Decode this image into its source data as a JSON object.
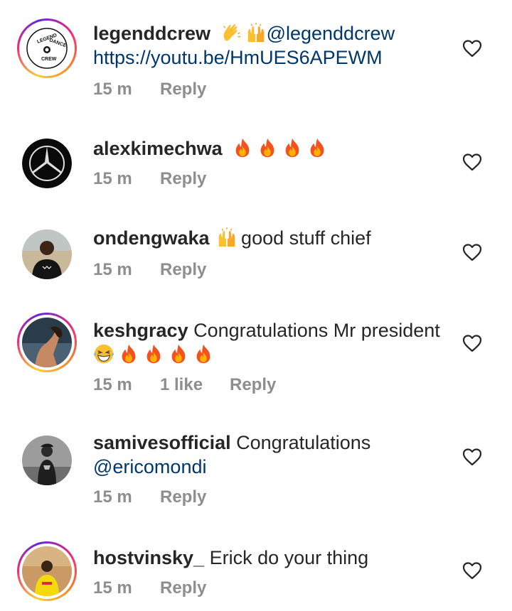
{
  "comments": [
    {
      "username": "legenddcrew",
      "emojis_before": [
        "clapping-hands-emoji",
        "raising-hands-emoji"
      ],
      "mention": "@legenddcrew",
      "link": "https://youtu.be/HmUES6APEWM",
      "time": "15 m",
      "reply": "Reply",
      "avatar_lines": [
        "LEGEND",
        "DANCE",
        "CREW"
      ]
    },
    {
      "username": "alexkimechwa",
      "emojis_after": [
        "fire-emoji",
        "fire-emoji",
        "fire-emoji",
        "fire-emoji"
      ],
      "time": "15 m",
      "reply": "Reply"
    },
    {
      "username": "ondengwaka",
      "emojis_before": [
        "raising-hands-emoji"
      ],
      "text": "good stuff chief",
      "time": "15 m",
      "reply": "Reply"
    },
    {
      "username": "keshgracy",
      "text": "Congratulations Mr president",
      "emojis_after": [
        "grinning-squinting-face-emoji",
        "fire-emoji",
        "fire-emoji",
        "fire-emoji",
        "fire-emoji"
      ],
      "time": "15 m",
      "likes": "1 like",
      "reply": "Reply"
    },
    {
      "username": "samivesofficial",
      "text": "Congratulations",
      "mention": "@ericomondi",
      "time": "15 m",
      "reply": "Reply"
    },
    {
      "username": "hostvinsky_",
      "text": "Erick do your thing",
      "time": "15 m",
      "reply": "Reply"
    }
  ],
  "icons": {
    "like": "heart-outline-icon"
  },
  "colors": {
    "text": "#262626",
    "secondary": "#8e8e8e",
    "link": "#00376b",
    "fire": "#f4511e"
  }
}
